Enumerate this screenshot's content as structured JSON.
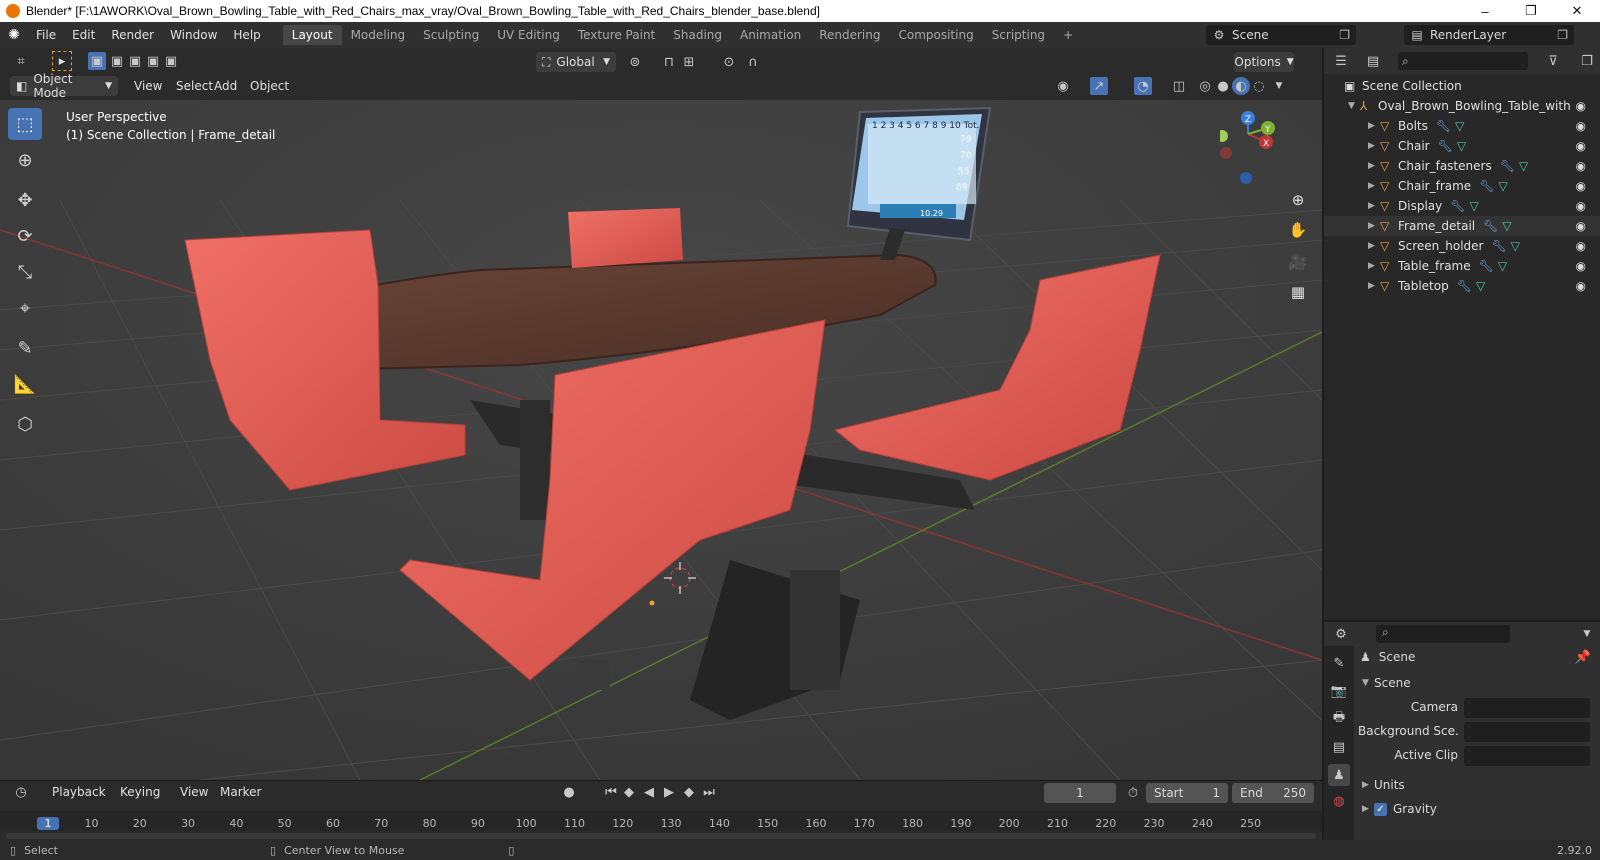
{
  "titlebar": {
    "title": "Blender* [F:\\1AWORK\\Oval_Brown_Bowling_Table_with_Red_Chairs_max_vray/Oval_Brown_Bowling_Table_with_Red_Chairs_blender_base.blend]",
    "minimize": "–",
    "maximize": "❐",
    "close": "✕"
  },
  "menubar": [
    "File",
    "Edit",
    "Render",
    "Window",
    "Help"
  ],
  "workspaces": [
    "Layout",
    "Modeling",
    "Sculpting",
    "UV Editing",
    "Texture Paint",
    "Shading",
    "Animation",
    "Rendering",
    "Compositing",
    "Scripting"
  ],
  "add_workspace": "+",
  "scene_field": "Scene",
  "renderlayer_field": "RenderLayer",
  "header": {
    "mode": "Object Mode",
    "menus": [
      "View",
      "Select",
      "Add",
      "Object"
    ],
    "orientation": "Global",
    "options": "Options"
  },
  "viewport": {
    "perspective": "User Perspective",
    "collection_info": "(1) Scene Collection | Frame_detail",
    "scoreboard_numbers": "1 2 3 4 5 6 7 8 9 10 Tot.",
    "scoreboard_totals": [
      "79",
      "70",
      "55",
      "69"
    ],
    "scoreboard_bottom": "10.29"
  },
  "gizmo": {
    "x": "X",
    "y": "Y",
    "z": "Z"
  },
  "outliner": {
    "root": "Scene Collection",
    "collection": "Oval_Brown_Bowling_Table_with",
    "items": [
      "Bolts",
      "Chair",
      "Chair_fasteners",
      "Chair_frame",
      "Display",
      "Frame_detail",
      "Screen_holder",
      "Table_frame",
      "Tabletop"
    ],
    "selected": "Frame_detail"
  },
  "properties": {
    "context": "Scene",
    "panel_title": "Scene",
    "camera_label": "Camera",
    "background_label": "Background Sce...",
    "active_clip_label": "Active Clip",
    "units_label": "Units",
    "gravity_label": "Gravity",
    "gravity_checked": true
  },
  "timeline": {
    "menus": [
      "Playback",
      "Keying",
      "View",
      "Marker"
    ],
    "current_frame": "1",
    "start_label": "Start",
    "start": "1",
    "end_label": "End",
    "end": "250",
    "ticks": [
      "1",
      "10",
      "20",
      "30",
      "40",
      "50",
      "60",
      "70",
      "80",
      "90",
      "100",
      "110",
      "120",
      "130",
      "140",
      "150",
      "160",
      "170",
      "180",
      "190",
      "200",
      "210",
      "220",
      "230",
      "240",
      "250"
    ]
  },
  "statusbar": {
    "select": "Select",
    "center": "Center View to Mouse",
    "version": "2.92.0"
  },
  "colors": {
    "accent": "#4772b3",
    "chair": "#e05a52",
    "table": "#5a3a30",
    "object_orange": "#e9a14a"
  }
}
